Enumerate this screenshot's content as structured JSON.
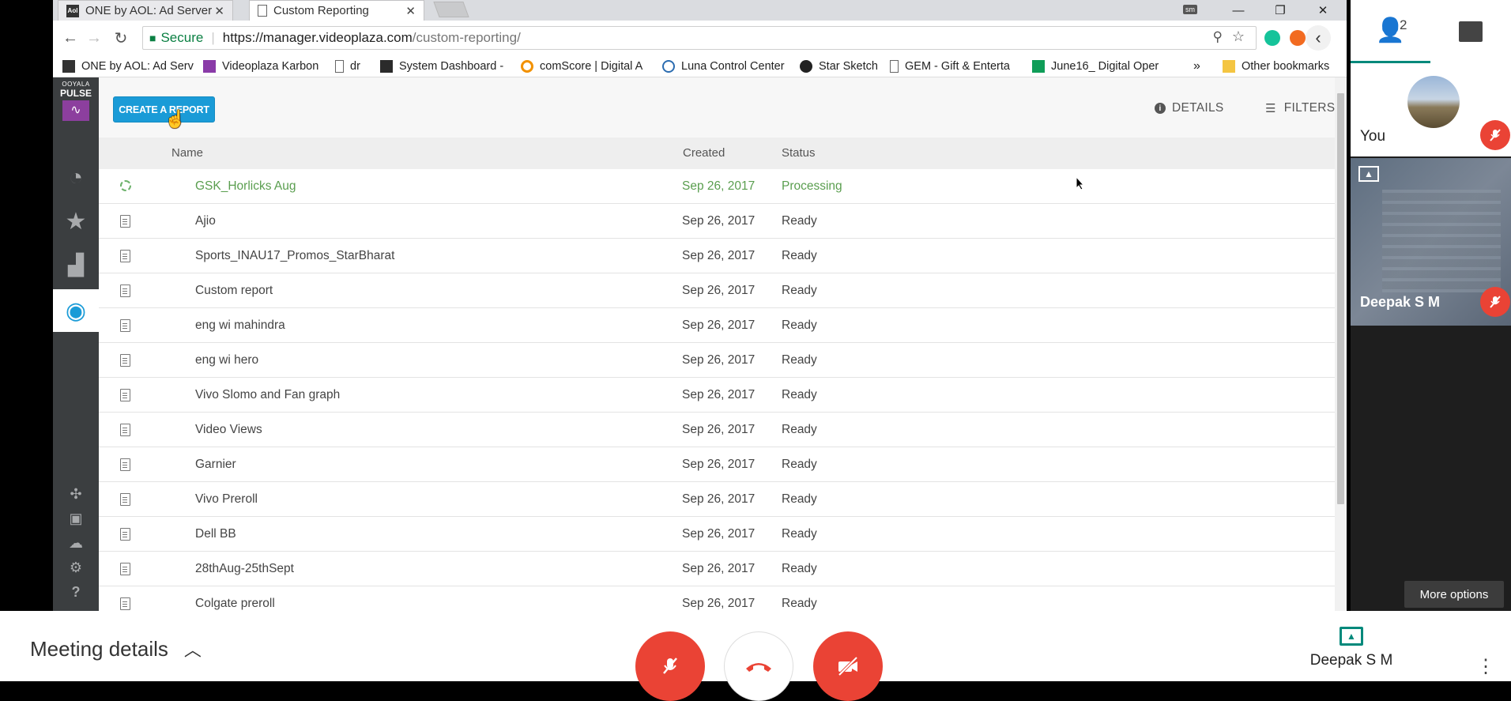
{
  "browser": {
    "tabs": [
      {
        "title": "ONE by AOL: Ad Server",
        "active": false
      },
      {
        "title": "Custom Reporting",
        "active": true
      }
    ],
    "profile_badge": "sm",
    "omnibox": {
      "secure_label": "Secure",
      "url_scheme_host": "https://manager.videoplaza.com",
      "url_path": "/custom-reporting/"
    },
    "bookmarks": [
      "ONE by AOL: Ad Serv",
      "Videoplaza Karbon",
      "dr",
      "System Dashboard - ",
      "comScore | Digital A",
      "Luna Control Center",
      "Star Sketch",
      "GEM - Gift & Enterta",
      "June16_ Digital Oper"
    ],
    "bookmarks_overflow": "»",
    "other_bookmarks": "Other bookmarks"
  },
  "app": {
    "logo_top": "OOYALA",
    "logo_bottom": "PULSE",
    "create_button": "CREATE A REPORT",
    "details_label": "DETAILS",
    "filters_label": "FILTERS",
    "columns": {
      "name": "Name",
      "created": "Created",
      "status": "Status"
    },
    "reports": [
      {
        "name": "GSK_Horlicks Aug",
        "created": "Sep 26, 2017",
        "status": "Processing"
      },
      {
        "name": "Ajio",
        "created": "Sep 26, 2017",
        "status": "Ready"
      },
      {
        "name": "Sports_INAU17_Promos_StarBharat",
        "created": "Sep 26, 2017",
        "status": "Ready"
      },
      {
        "name": "Custom report",
        "created": "Sep 26, 2017",
        "status": "Ready"
      },
      {
        "name": "eng wi mahindra",
        "created": "Sep 26, 2017",
        "status": "Ready"
      },
      {
        "name": "eng wi hero",
        "created": "Sep 26, 2017",
        "status": "Ready"
      },
      {
        "name": "Vivo Slomo and Fan graph",
        "created": "Sep 26, 2017",
        "status": "Ready"
      },
      {
        "name": "Video Views",
        "created": "Sep 26, 2017",
        "status": "Ready"
      },
      {
        "name": "Garnier",
        "created": "Sep 26, 2017",
        "status": "Ready"
      },
      {
        "name": "Vivo Preroll",
        "created": "Sep 26, 2017",
        "status": "Ready"
      },
      {
        "name": "Dell BB",
        "created": "Sep 26, 2017",
        "status": "Ready"
      },
      {
        "name": "28thAug-25thSept",
        "created": "Sep 26, 2017",
        "status": "Ready"
      },
      {
        "name": "Colgate preroll",
        "created": "Sep 26, 2017",
        "status": "Ready"
      }
    ]
  },
  "meet": {
    "participant_count": "2",
    "you_label": "You",
    "presenter_tile_name": "Deepak S M",
    "more_options": "More options",
    "meeting_details": "Meeting details",
    "presenter_name": "Deepak S M"
  },
  "colors": {
    "accent": "#1a9bd7",
    "processing": "#5a9e4f",
    "meet_red": "#ea4335",
    "meet_teal": "#00897b"
  }
}
